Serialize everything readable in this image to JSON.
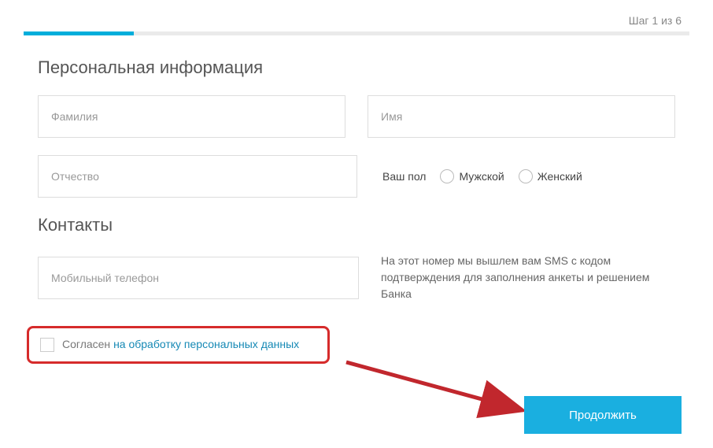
{
  "step": {
    "label": "Шаг 1 из 6"
  },
  "sections": {
    "personal": {
      "title": "Персональная информация"
    },
    "contacts": {
      "title": "Контакты"
    }
  },
  "fields": {
    "surname": {
      "placeholder": "Фамилия"
    },
    "name": {
      "placeholder": "Имя"
    },
    "patronymic": {
      "placeholder": "Отчество"
    },
    "phone": {
      "placeholder": "Мобильный телефон"
    }
  },
  "gender": {
    "label": "Ваш пол",
    "options": {
      "male": "Мужской",
      "female": "Женский"
    }
  },
  "sms_hint": "На этот номер мы вышлем вам SMS с кодом подтверждения для заполнения анкеты и решением Банка",
  "consent": {
    "prefix": "Согласен ",
    "link": "на обработку персональных данных"
  },
  "buttons": {
    "continue": "Продолжить"
  }
}
